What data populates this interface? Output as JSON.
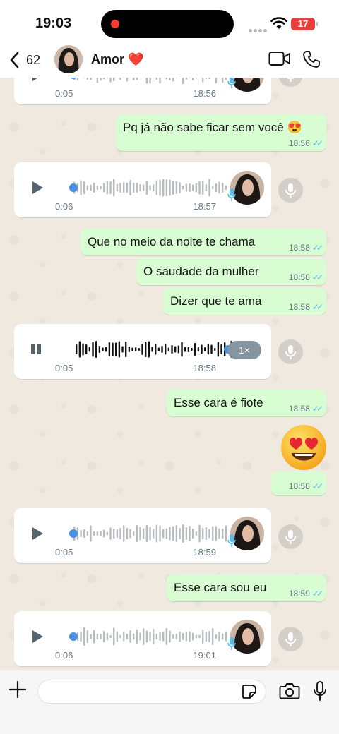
{
  "status_bar": {
    "time": "19:03",
    "battery": "17",
    "icons": [
      "signal-dots",
      "wifi-icon",
      "battery-icon"
    ]
  },
  "header": {
    "back_count": "62",
    "contact_name": "Amor ❤️",
    "icons": [
      "chevron-left-icon",
      "video-call-icon",
      "phone-icon"
    ]
  },
  "messages": [
    {
      "type": "voice",
      "duration": "0:05",
      "time": "18:56"
    },
    {
      "type": "text",
      "text": "Pq já não sabe ficar sem você 😍",
      "time": "18:56"
    },
    {
      "type": "voice",
      "duration": "0:06",
      "time": "18:57"
    },
    {
      "type": "text",
      "text": "Que no meio da noite te chama",
      "time": "18:58"
    },
    {
      "type": "text",
      "text": "O saudade da mulher",
      "time": "18:58"
    },
    {
      "type": "text",
      "text": "Dizer que te ama",
      "time": "18:58"
    },
    {
      "type": "voice",
      "duration": "0:05",
      "time": "18:58",
      "speed": "1×",
      "playing": true
    },
    {
      "type": "text",
      "text": "Esse cara é fiote",
      "time": "18:58"
    },
    {
      "type": "emoji",
      "text": "😍",
      "time": "18:58"
    },
    {
      "type": "voice",
      "duration": "0:05",
      "time": "18:59"
    },
    {
      "type": "text",
      "text": "Esse cara sou eu",
      "time": "18:59"
    },
    {
      "type": "voice",
      "duration": "0:06",
      "time": "19:01"
    }
  ],
  "composer": {
    "placeholder": "",
    "icons": [
      "plus-icon",
      "sticker-icon",
      "camera-icon",
      "mic-icon"
    ]
  },
  "colors": {
    "outgoing_bubble": "#d9fdd3",
    "incoming_bubble": "#ffffff",
    "read_ticks": "#53bdeb",
    "chat_background": "#efe9df"
  }
}
